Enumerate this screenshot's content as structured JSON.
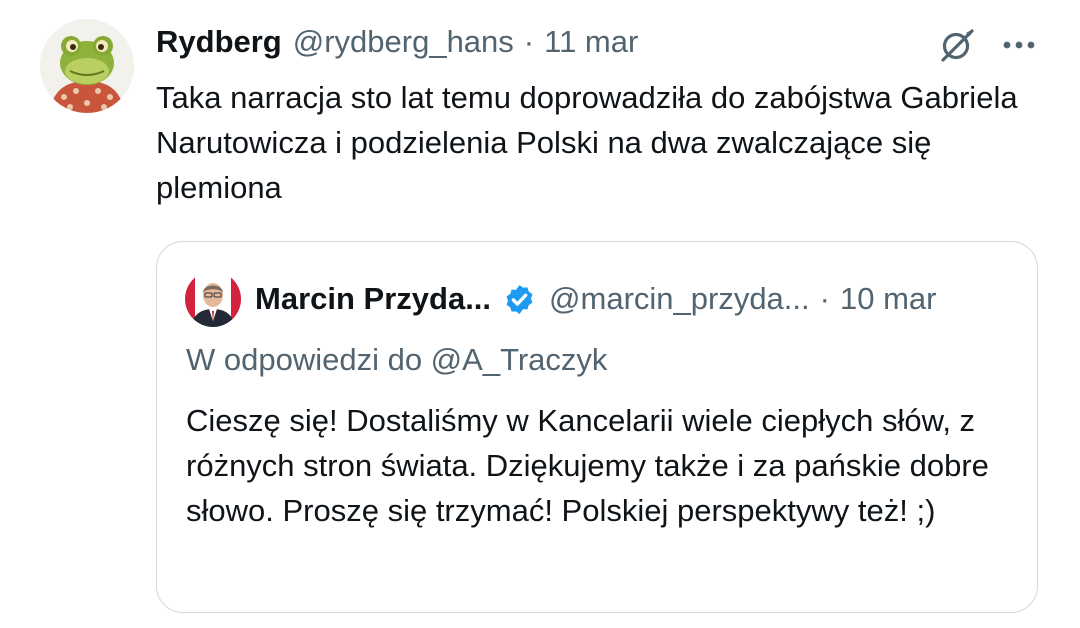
{
  "tweet": {
    "author": {
      "display_name": "Rydberg",
      "handle": "@rydberg_hans",
      "avatar_icon": "frog-avatar"
    },
    "separator": "·",
    "date": "11 mar",
    "text": "Taka narracja sto lat temu doprowadziła do zabójstwa Gabriela Narutowicza i podzielenia Polski na dwa zwalczające się plemiona",
    "actions": {
      "grok_icon": "grok-icon",
      "more_icon": "more-icon"
    }
  },
  "quoted_tweet": {
    "author": {
      "display_name": "Marcin Przyda...",
      "handle": "@marcin_przyda...",
      "verified_icon": "verified-badge-icon",
      "avatar_icon": "man-in-suit-avatar"
    },
    "separator": "·",
    "date": "10 mar",
    "reply_to": "W odpowiedzi do @A_Traczyk",
    "text": "Cieszę się! Dostaliśmy w Kancelarii wiele ciepłych słów, z różnych stron świata. Dziękujemy także i za pańskie dobre słowo. Proszę się trzymać! Polskiej perspektywy też! ;)"
  },
  "colors": {
    "text_primary": "#0f1419",
    "text_secondary": "#536471",
    "border": "#cfd9de",
    "verified_blue": "#1d9bf0"
  }
}
